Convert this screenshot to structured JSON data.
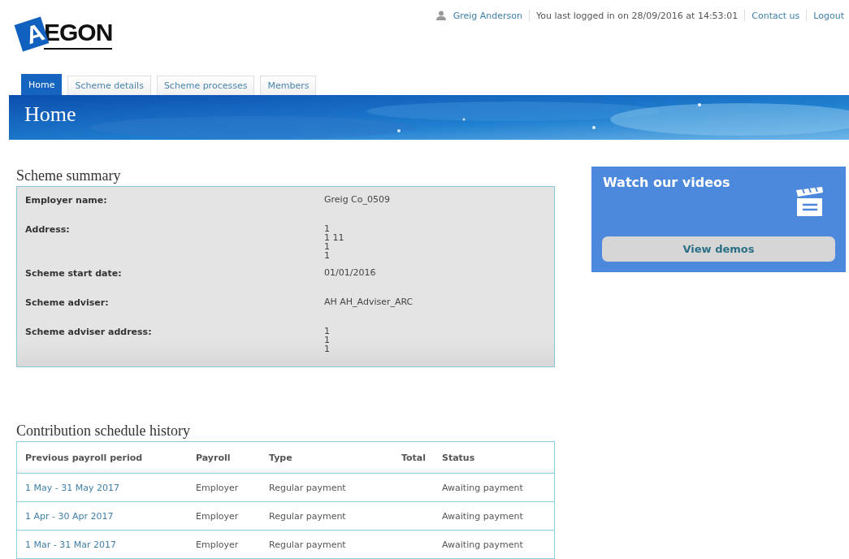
{
  "logo": {
    "text": "EGON",
    "initial": "A"
  },
  "header": {
    "user": "Greig Anderson",
    "last_login": "You last logged in on 28/09/2016 at 14:53:01",
    "links": [
      "Contact us",
      "Logout"
    ]
  },
  "tabs": [
    {
      "label": "Home",
      "selected": true
    },
    {
      "label": "Scheme details",
      "selected": false
    },
    {
      "label": "Scheme processes",
      "selected": false
    },
    {
      "label": "Members",
      "selected": false
    }
  ],
  "banner": {
    "title": "Home"
  },
  "scheme_summary": {
    "title": "Scheme summary",
    "fields": [
      {
        "label": "Employer name:",
        "lines": [
          "Greig Co_0509"
        ]
      },
      {
        "label": "Address:",
        "lines": [
          "1",
          "1 11",
          "1",
          "1"
        ]
      },
      {
        "label": "Scheme start date:",
        "lines": [
          "01/01/2016"
        ]
      },
      {
        "label": "Scheme adviser:",
        "lines": [
          "AH AH_Adviser_ARC"
        ]
      },
      {
        "label": "Scheme adviser address:",
        "lines": [
          "1",
          "1",
          "1"
        ]
      }
    ]
  },
  "videos": {
    "title": "Watch our videos",
    "button": "View demos"
  },
  "contributions": {
    "title": "Contribution schedule history",
    "columns": [
      "Previous payroll period",
      "Payroll",
      "Type",
      "Total",
      "Status"
    ],
    "rows": [
      [
        "1 May - 31 May 2017",
        "Employer",
        "Regular payment",
        "",
        "Awaiting payment"
      ],
      [
        "1 Apr - 30 Apr 2017",
        "Employer",
        "Regular payment",
        "",
        "Awaiting payment"
      ],
      [
        "1 Mar - 31 Mar 2017",
        "Employer",
        "Regular payment",
        "",
        "Awaiting payment"
      ]
    ]
  }
}
